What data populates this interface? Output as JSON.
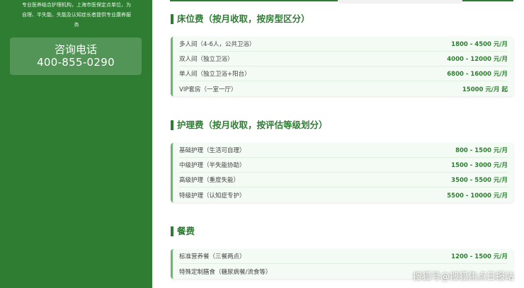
{
  "sidebar": {
    "intro_lines": [
      "专业医养结合护理机构，上海市医保定点单位，为",
      "自理、半失能、失能及认知症长者提供专业康养服",
      "务"
    ],
    "phone_label": "咨询电话",
    "phone_number": "400-855-0290"
  },
  "sections": [
    {
      "title": "床位费（按月收取，按房型区分）",
      "rows": [
        {
          "name": "多人间（4-6人，公共卫浴）",
          "price": "1800 - 4500 元/月"
        },
        {
          "name": "双人间（独立卫浴）",
          "price": "4000 - 12000 元/月"
        },
        {
          "name": "单人间（独立卫浴+阳台）",
          "price": "6800 - 16000 元/月"
        },
        {
          "name": "VIP套房（一室一厅）",
          "price": "15000 元/月 起"
        }
      ]
    },
    {
      "title": "护理费（按月收取，按评估等级划分）",
      "rows": [
        {
          "name": "基础护理（生活可自理）",
          "price": "800 - 1500 元/月"
        },
        {
          "name": "中级护理（半失能协助）",
          "price": "1500 - 3000 元/月"
        },
        {
          "name": "高级护理（重度失能）",
          "price": "3500 - 5500 元/月"
        },
        {
          "name": "特级护理（认知症专护）",
          "price": "5500 - 10000 元/月"
        }
      ]
    },
    {
      "title": "餐费",
      "rows": [
        {
          "name": "标准营养餐（三餐两点）",
          "price": "1200 - 1500 元/月"
        },
        {
          "name": "特殊定制膳食（糖尿病餐/流食等）",
          "price": ""
        }
      ]
    }
  ],
  "watermark": "搜狐号@搜狐焦点日报站",
  "colors": {
    "primary": "#2e7d32",
    "card_bg": "#f4fbf4",
    "accent_border": "#66bb6a"
  }
}
